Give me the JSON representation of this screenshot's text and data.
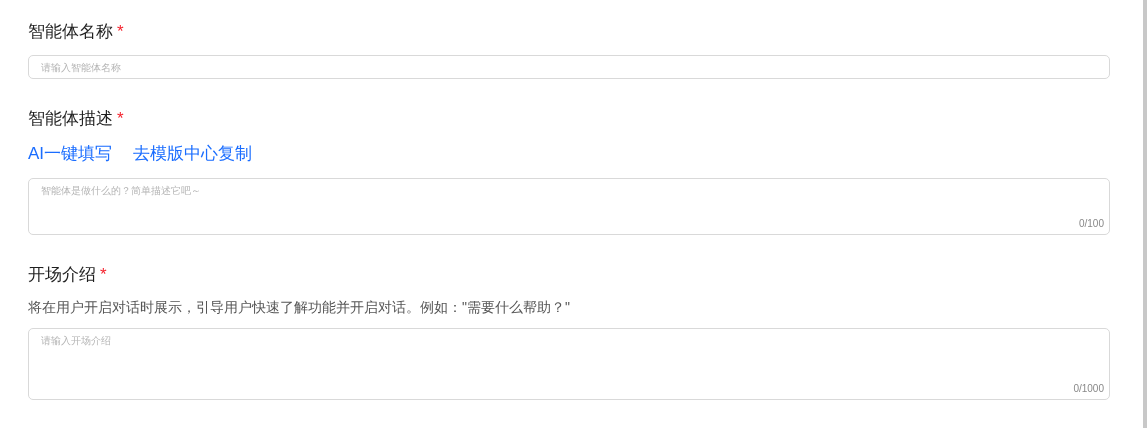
{
  "fields": [
    {
      "kind": "input",
      "label": "智能体名称",
      "required_mark": "*",
      "placeholder": "请输入智能体名称"
    },
    {
      "kind": "textarea",
      "label": "智能体描述",
      "required_mark": "*",
      "links": [
        "AI一键填写",
        "去模版中心复制"
      ],
      "placeholder": "智能体是做什么的？简单描述它吧～",
      "counter": "0/100"
    },
    {
      "kind": "textarea",
      "label": "开场介绍",
      "required_mark": "*",
      "description": "将在用户开启对话时展示，引导用户快速了解功能并开启对话。例如：\"需要什么帮助？\"",
      "placeholder": "请输入开场介绍",
      "counter": "0/1000"
    }
  ]
}
